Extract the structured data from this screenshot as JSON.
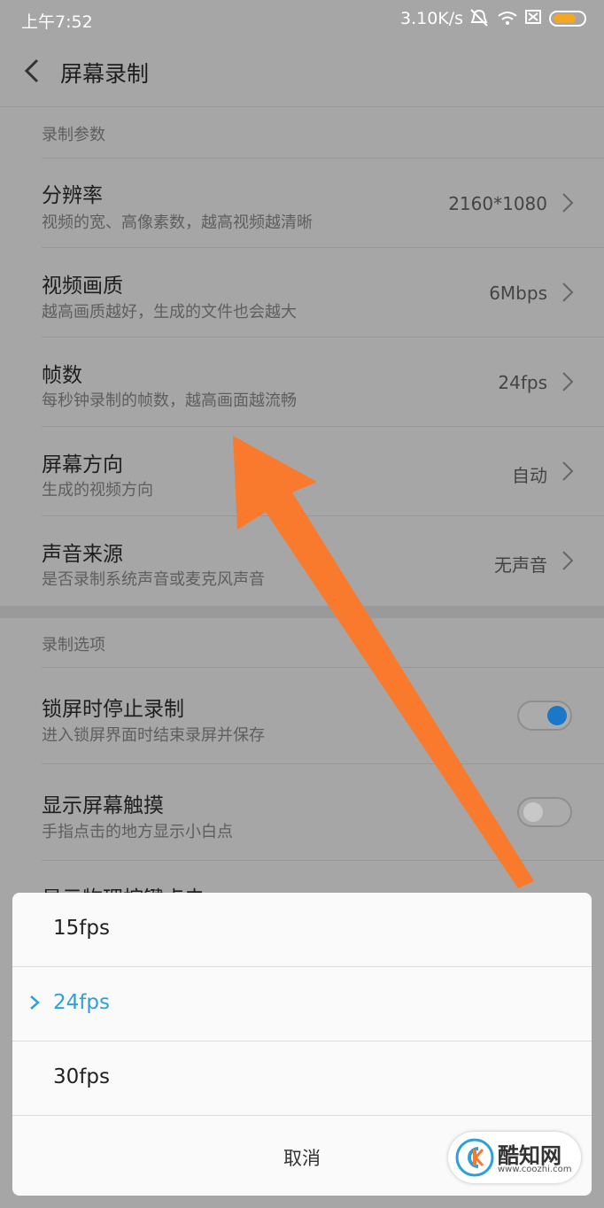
{
  "status_bar": {
    "time": "上午7:52",
    "net_speed": "3.10K/s",
    "icons": [
      "alarm-off-icon",
      "wifi-icon",
      "sim-off-icon",
      "battery-icon"
    ],
    "battery_color": "#f5a623"
  },
  "header": {
    "title": "屏幕录制",
    "back_icon": "chevron-left-icon"
  },
  "section_params": {
    "label": "录制参数",
    "items": [
      {
        "title": "分辨率",
        "subtitle": "视频的宽、高像素数，越高视频越清晰",
        "value": "2160*1080"
      },
      {
        "title": "视频画质",
        "subtitle": "越高画质越好，生成的文件也会越大",
        "value": "6Mbps"
      },
      {
        "title": "帧数",
        "subtitle": "每秒钟录制的帧数，越高画面越流畅",
        "value": "24fps"
      },
      {
        "title": "屏幕方向",
        "subtitle": "生成的视频方向",
        "value": "自动"
      },
      {
        "title": "声音来源",
        "subtitle": "是否录制系统声音或麦克风声音",
        "value": "无声音"
      }
    ]
  },
  "section_options": {
    "label": "录制选项",
    "items": [
      {
        "title": "锁屏时停止录制",
        "subtitle": "进入锁屏界面时结束录屏并保存",
        "toggle_on": true
      },
      {
        "title": "显示屏幕触摸",
        "subtitle": "手指点击的地方显示小白点",
        "toggle_on": false
      },
      {
        "title": "显示物理按键点击"
      }
    ],
    "toggle_on_color": "#1a77c9"
  },
  "annotation": {
    "arrow_color": "#f97a2d"
  },
  "sheet": {
    "options": [
      {
        "label": "15fps",
        "selected": false
      },
      {
        "label": "24fps",
        "selected": true
      },
      {
        "label": "30fps",
        "selected": false
      }
    ],
    "cancel_label": "取消",
    "selected_color": "#2ea0d8"
  },
  "watermark": {
    "brand": "酷知网",
    "url": "www.coozhi.com"
  }
}
